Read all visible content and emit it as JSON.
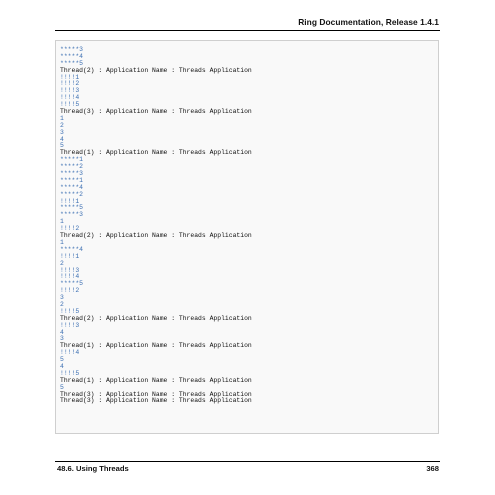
{
  "header": {
    "title": "Ring Documentation, Release 1.4.1"
  },
  "code_block": {
    "lines": [
      "*****3",
      "*****4",
      "*****5",
      "Thread(2) : Application Name : Threads Application",
      "!!!!1",
      "!!!!2",
      "!!!!3",
      "!!!!4",
      "!!!!5",
      "Thread(3) : Application Name : Threads Application",
      "1",
      "2",
      "3",
      "4",
      "5",
      "Thread(1) : Application Name : Threads Application",
      "*****1",
      "*****2",
      "*****3",
      "*****1",
      "*****4",
      "*****2",
      "!!!!1",
      "*****5",
      "*****3",
      "1",
      "!!!!2",
      "Thread(2) : Application Name : Threads Application",
      "1",
      "*****4",
      "!!!!1",
      "2",
      "!!!!3",
      "!!!!4",
      "*****5",
      "!!!!2",
      "3",
      "2",
      "!!!!5",
      "Thread(2) : Application Name : Threads Application",
      "!!!!3",
      "4",
      "3",
      "Thread(1) : Application Name : Threads Application",
      "!!!!4",
      "5",
      "4",
      "!!!!5",
      "Thread(1) : Application Name : Threads Application",
      "5",
      "Thread(3) : Application Name : Threads Application",
      "Thread(3) : Application Name : Threads Application"
    ]
  },
  "footer": {
    "section": "48.6.  Using Threads",
    "page_number": "368"
  }
}
